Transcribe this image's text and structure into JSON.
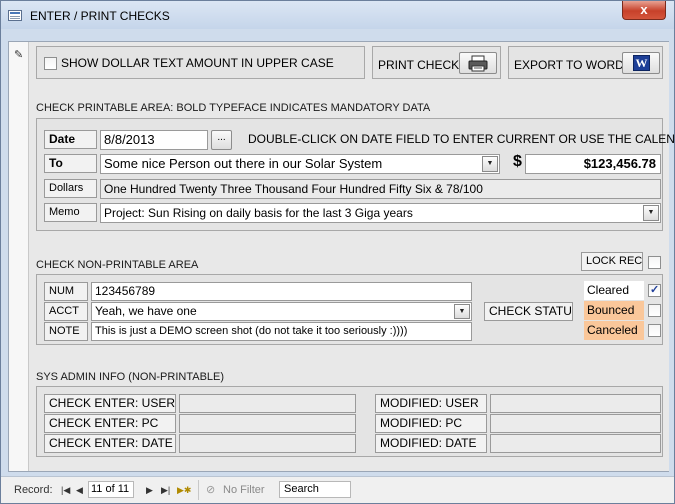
{
  "window": {
    "title": "ENTER / PRINT CHECKS",
    "close_glyph": "x"
  },
  "toolbar": {
    "upper_case_label": "SHOW DOLLAR TEXT AMOUNT IN UPPER CASE",
    "upper_case_checked": false,
    "print_label": "PRINT CHECK",
    "export_label": "EXPORT TO WORD",
    "print_icon": "printer-icon",
    "export_icon": "word-icon",
    "word_glyph": "W"
  },
  "printable": {
    "heading": "CHECK PRINTABLE AREA: BOLD TYPEFACE INDICATES MANDATORY DATA",
    "date_label": "Date",
    "date_value": "8/8/2013",
    "date_picker_label": "...",
    "date_hint": "DOUBLE-CLICK ON DATE FIELD TO ENTER CURRENT OR USE THE CALENDAR",
    "to_label": "To",
    "to_value": "Some nice Person out there in our Solar System",
    "currency_symbol": "$",
    "amount_value": "$123,456.78",
    "dollars_label": "Dollars",
    "dollars_value": "One Hundred Twenty Three Thousand Four Hundred Fifty Six & 78/100",
    "memo_label": "Memo",
    "memo_value": "Project: Sun Rising on daily basis for the last 3 Giga years"
  },
  "nonprintable": {
    "heading": "CHECK NON-PRINTABLE AREA",
    "lock_label": "LOCK REC",
    "lock_checked": false,
    "num_label": "NUM",
    "num_value": "123456789",
    "acct_label": "ACCT",
    "acct_value": "Yeah, we have one",
    "note_label": "NOTE",
    "note_value": "This is just a DEMO screen shot (do not take it too seriously :))))",
    "check_status_label": "CHECK STATUS",
    "statuses": [
      {
        "label": "Cleared",
        "checked": true,
        "color": "#ffffff"
      },
      {
        "label": "Bounced",
        "checked": false,
        "color": "#fac79a"
      },
      {
        "label": "Canceled",
        "checked": false,
        "color": "#fac79a"
      }
    ]
  },
  "sysadmin": {
    "heading": "SYS ADMIN INFO (NON-PRINTABLE)",
    "enter_user_label": "CHECK ENTER: USER",
    "enter_pc_label": "CHECK ENTER: PC",
    "enter_date_label": "CHECK ENTER: DATE",
    "mod_user_label": "MODIFIED: USER",
    "mod_pc_label": "MODIFIED: PC",
    "mod_date_label": "MODIFIED: DATE"
  },
  "statusbar": {
    "record_label": "Record:",
    "record_position": "11 of 11",
    "filter_label": "No Filter",
    "search_label": "Search"
  }
}
